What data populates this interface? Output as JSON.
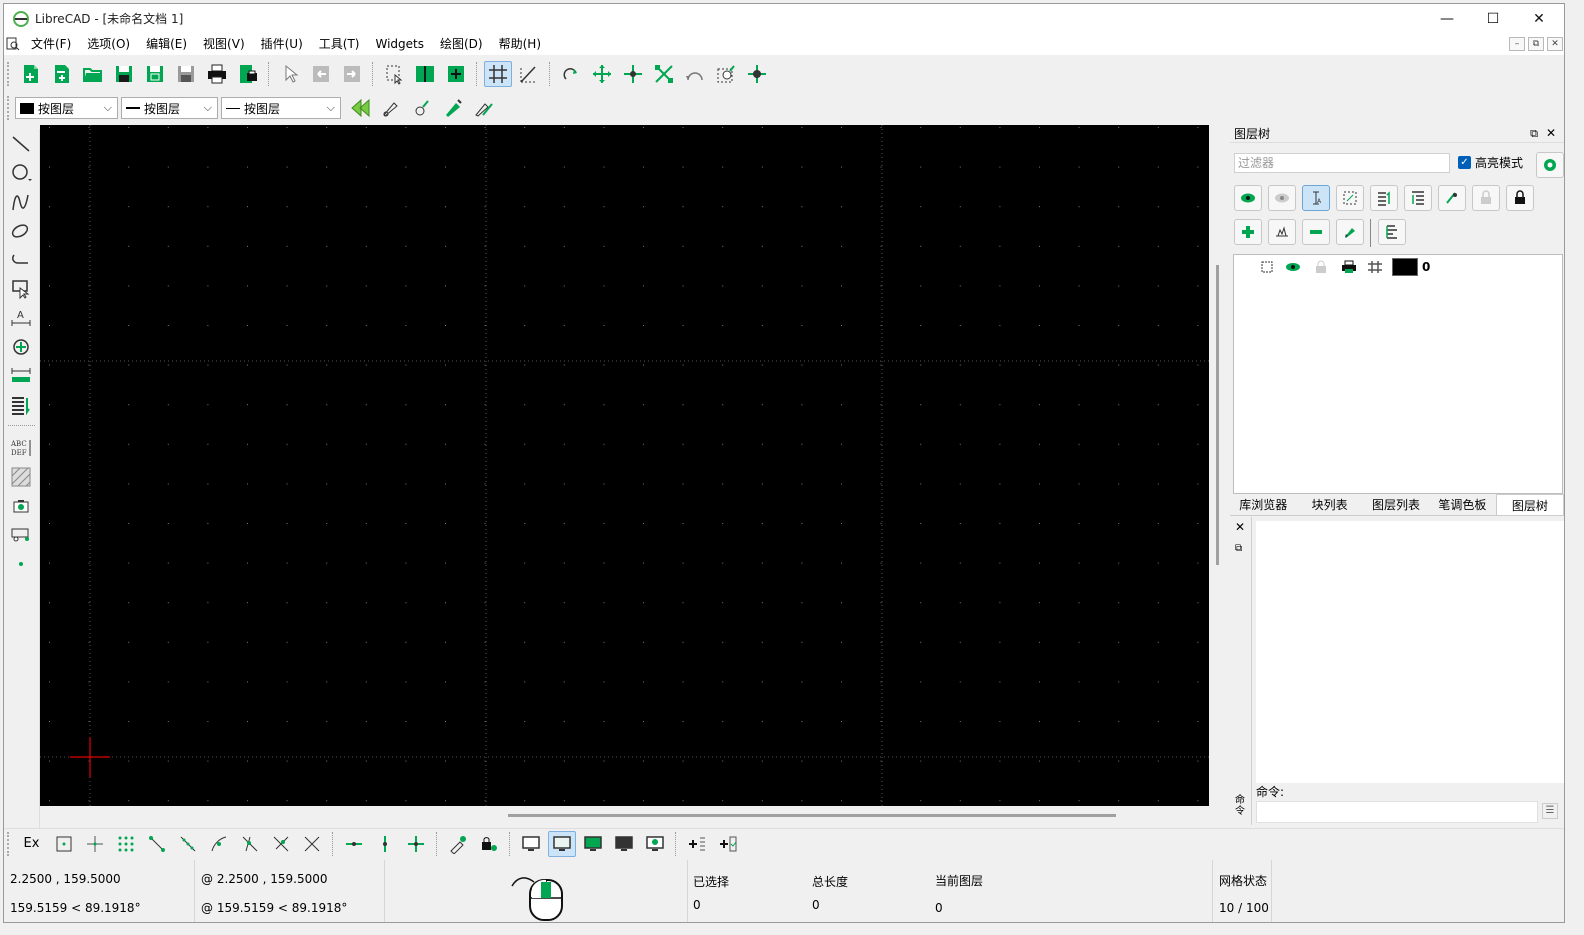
{
  "window": {
    "title": "LibreCAD - [未命名文档 1]",
    "minimize_glyph": "—",
    "maximize_glyph": "☐",
    "close_glyph": "✕"
  },
  "menu": {
    "items": [
      "文件(F)",
      "选项(O)",
      "编辑(E)",
      "视图(V)",
      "插件(U)",
      "工具(T)",
      "Widgets",
      "绘图(D)",
      "帮助(H)"
    ],
    "mdi_minimize": "–",
    "mdi_restore": "⧉",
    "mdi_close": "✕"
  },
  "pen_toolbar": {
    "color": "按图层",
    "width": "按图层",
    "linetype": "按图层"
  },
  "layer_dock": {
    "title": "图层树",
    "filter_placeholder": "过滤器",
    "highlight_mode": "高亮模式",
    "highlight_checked": true,
    "layers": [
      {
        "name": "0",
        "color": "#000000"
      }
    ]
  },
  "dock_tabs": [
    "库浏览器",
    "块列表",
    "图层列表",
    "笔调色板",
    "图层树"
  ],
  "selected_tab": "图层树",
  "command": {
    "label": "命令:",
    "side_label": "命令"
  },
  "bottom_toolbar": {
    "ex_label": "Ex"
  },
  "status": {
    "abs_coord": "2.2500 , 159.5000",
    "abs_polar": "159.5159 < 89.1918°",
    "rel_coord": "@  2.2500 , 159.5000",
    "rel_polar": "@  159.5159 < 89.1918°",
    "selected_label": "已选择",
    "selected_value": "0",
    "total_length_label": "总长度",
    "total_length_value": "0",
    "current_layer_label": "当前图层",
    "current_layer_value": "0",
    "grid_status_label": "网格状态",
    "grid_status_value": "10 / 100"
  },
  "colors": {
    "canvas_bg": "#000000",
    "accent": "#00a651",
    "crosshair": "#e00000",
    "grid_dot": "#7a7a7a"
  }
}
